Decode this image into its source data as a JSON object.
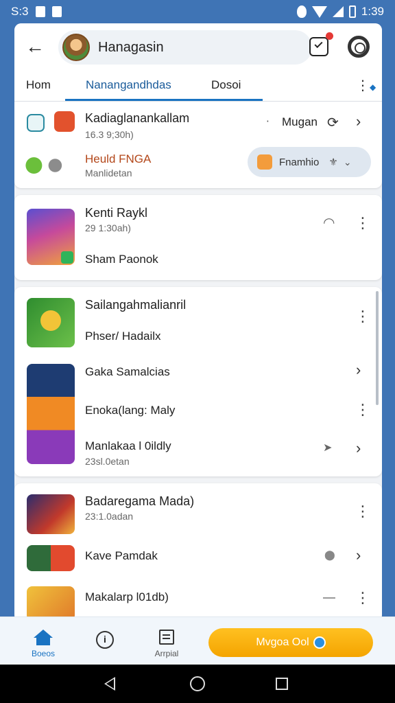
{
  "status_bar": {
    "time_left": "S:3",
    "time_right": "1:39"
  },
  "header": {
    "back_icon": "arrow-left-icon",
    "title": "Hanagasin",
    "bag_icon": "shopping-bag-icon",
    "settings_icon": "gear-icon"
  },
  "tabs": [
    {
      "label": "Hom",
      "active": false
    },
    {
      "label": "Nanangandhdas",
      "active": true
    },
    {
      "label": "Dosoi",
      "active": false
    }
  ],
  "top_card": {
    "row1": {
      "title": "Kadiaglanankallam",
      "subtitle": "16.3 9;30h)",
      "right_label": "Mugan"
    },
    "row2": {
      "title": "Heuld FNGA",
      "subtitle": "Manlidetan",
      "pill_label": "Fnamhio"
    }
  },
  "card2": {
    "title": "Kenti Raykl",
    "subtitle": "29 1:30ah)",
    "line2": "Sham Paonok"
  },
  "card3": {
    "rows": [
      {
        "title": "Sailangahmalianril",
        "subtitle": ""
      },
      {
        "title": "Phser/ Hadailx",
        "subtitle": ""
      },
      {
        "title": "Gaka Samalcias",
        "subtitle": ""
      },
      {
        "title": "Enoka(lang: Maly",
        "subtitle": ""
      },
      {
        "title": "Manlakaa l 0ildly",
        "subtitle": "23sl.0etan"
      }
    ]
  },
  "card4": {
    "rows": [
      {
        "title": "Badaregama Mada)",
        "subtitle": "23:1.0adan"
      },
      {
        "title": "Kave Pamdak",
        "subtitle": ""
      },
      {
        "title": "Makalarp l01db)",
        "subtitle": ""
      }
    ]
  },
  "bottom_nav": {
    "home_label": "Boeos",
    "info_label": "",
    "doc_label": "Arrpial",
    "cta_label": "Mvgoa Ool"
  },
  "colors": {
    "accent": "#1a73c2",
    "cta": "#f4a400",
    "status_bar": "#3f74b5"
  }
}
